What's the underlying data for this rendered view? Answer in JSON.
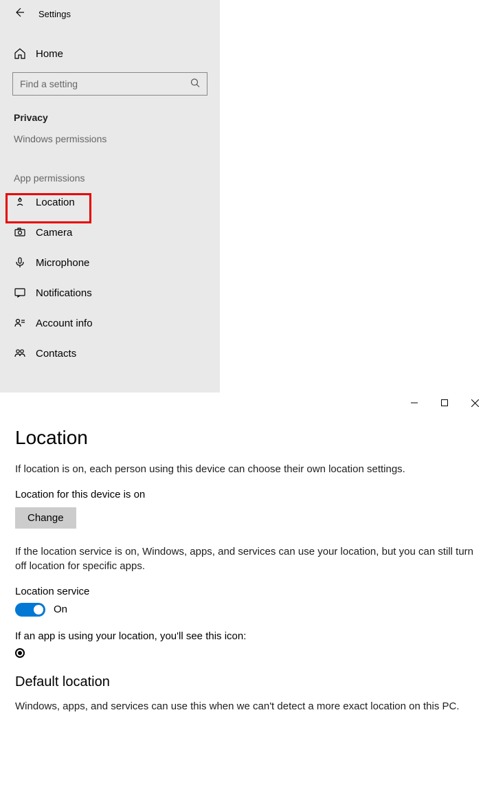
{
  "window": {
    "title": "Settings"
  },
  "sidebar": {
    "home_label": "Home",
    "search_placeholder": "Find a setting",
    "section_privacy": "Privacy",
    "section_winperm": "Windows permissions",
    "section_appperm": "App permissions",
    "items": [
      {
        "label": "Location"
      },
      {
        "label": "Camera"
      },
      {
        "label": "Microphone"
      },
      {
        "label": "Notifications"
      },
      {
        "label": "Account info"
      },
      {
        "label": "Contacts"
      }
    ]
  },
  "main": {
    "heading": "Location",
    "intro": "If location is on, each person using this device can choose their own location settings.",
    "device_status": "Location for this device is on",
    "change_label": "Change",
    "service_desc": "If the location service is on, Windows, apps, and services can use your location, but you can still turn off location for specific apps.",
    "service_label": "Location service",
    "toggle_state": "On",
    "usage_line": "If an app is using your location, you'll see this icon:",
    "default_heading": "Default location",
    "default_desc": "Windows, apps, and services can use this when we can't detect a more exact location on this PC."
  }
}
